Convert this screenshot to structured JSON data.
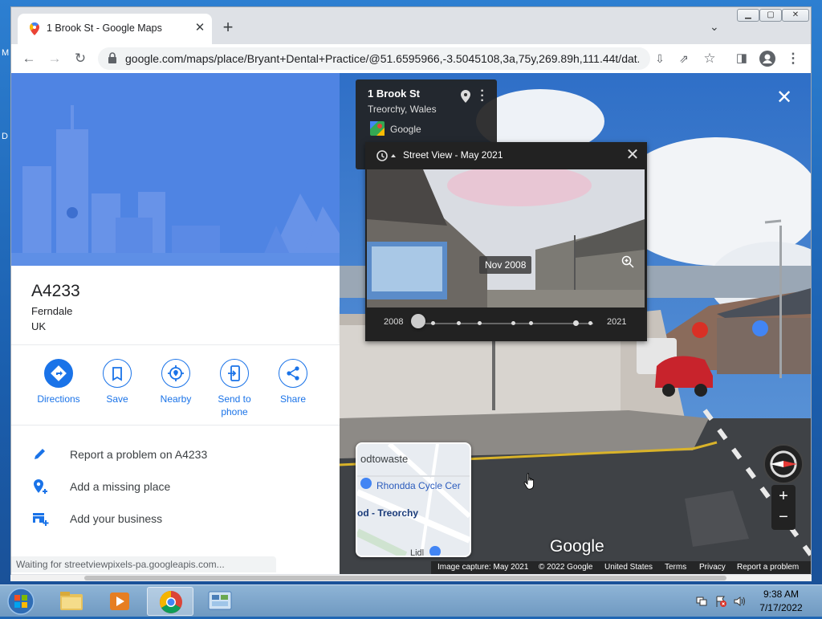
{
  "browser": {
    "tab_title": "1 Brook St - Google Maps",
    "url": "google.com/maps/place/Bryant+Dental+Practice/@51.6595966,-3.5045108,3a,75y,269.89h,111.44t/dat..."
  },
  "place": {
    "title": "A4233",
    "line1": "Ferndale",
    "line2": "UK"
  },
  "actions": [
    {
      "label": "Directions",
      "icon": "directions-icon"
    },
    {
      "label": "Save",
      "icon": "bookmark-icon"
    },
    {
      "label": "Nearby",
      "icon": "nearby-icon"
    },
    {
      "label": "Send to phone",
      "icon": "send-to-phone-icon"
    },
    {
      "label": "Share",
      "icon": "share-icon"
    }
  ],
  "rows": [
    {
      "label": "Report a problem on A4233",
      "icon": "pencil-icon"
    },
    {
      "label": "Add a missing place",
      "icon": "add-location-icon"
    },
    {
      "label": "Add your business",
      "icon": "add-business-icon"
    }
  ],
  "status": "Waiting for streetviewpixels-pa.googleapis.com...",
  "streetview": {
    "card_title": "1 Brook St",
    "card_subtitle": "Treorchy, Wales",
    "card_source": "Google",
    "timemachine_title": "Street View - May 2021",
    "preview_date": "Nov 2008",
    "year_start": "2008",
    "year_end": "2021",
    "slider_position": 0,
    "logo": "Google",
    "minimap_labels": [
      "odtowaste",
      "Rhondda Cycle Cer",
      "od - Treorchy",
      "Lidl"
    ],
    "footer": {
      "capture": "Image capture: May 2021",
      "copyright": "© 2022 Google",
      "country": "United States",
      "terms": "Terms",
      "privacy": "Privacy",
      "report": "Report a problem"
    }
  },
  "taskbar": {
    "time": "9:38 AM",
    "date": "7/17/2022"
  },
  "desktop_fragments": [
    "M",
    "D"
  ],
  "colors": {
    "accent": "#1a73e8",
    "hero": "#4a7fe0",
    "taskbar": "#7aa3c9"
  }
}
